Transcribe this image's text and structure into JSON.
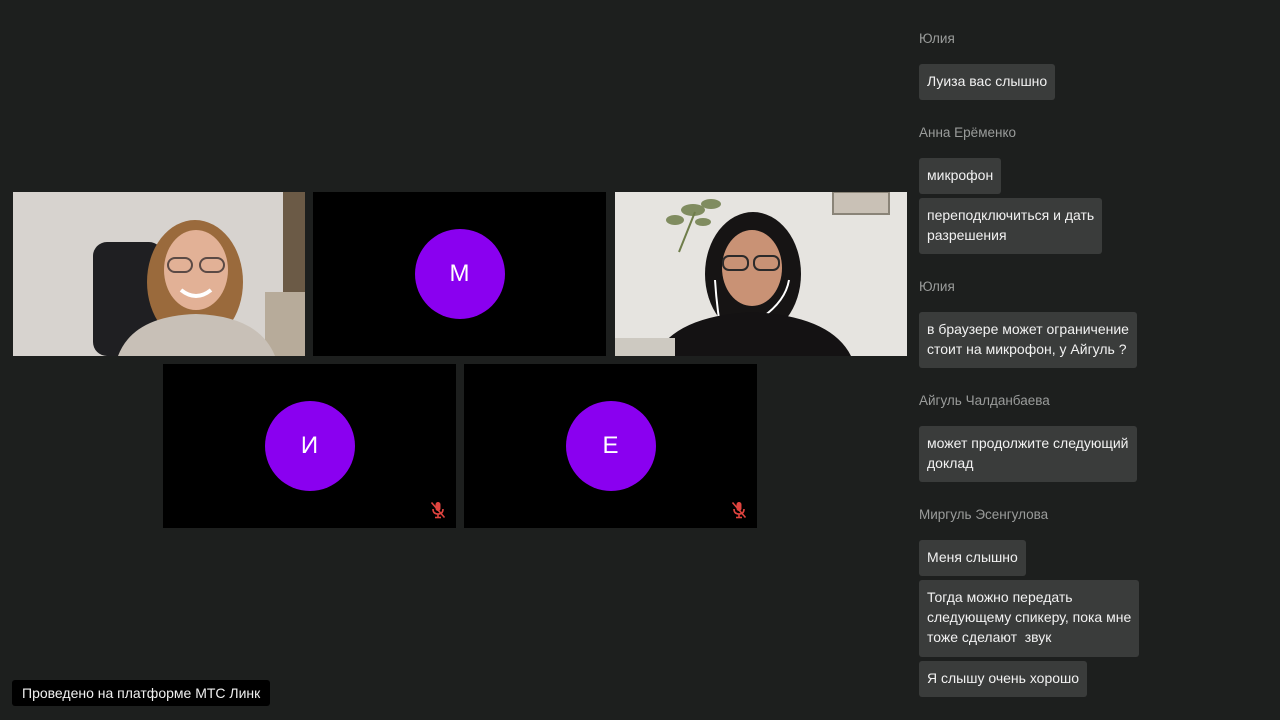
{
  "colors": {
    "background": "#1d1f1e",
    "avatar": "#8a00f0",
    "bubble": "#3a3c3b",
    "mic_off": "#e0443f"
  },
  "participants": [
    {
      "kind": "video",
      "description_icon": "participant-video-woman-smiling"
    },
    {
      "kind": "avatar",
      "initial": "М",
      "muted": false
    },
    {
      "kind": "video",
      "description_icon": "participant-video-woman-headphones"
    },
    {
      "kind": "avatar",
      "initial": "И",
      "muted": true
    },
    {
      "kind": "avatar",
      "initial": "Е",
      "muted": true
    }
  ],
  "chat": {
    "groups": [
      {
        "sender": "Юлия",
        "messages": [
          "Луиза вас слышно"
        ]
      },
      {
        "sender": "Анна Ерёменко",
        "messages": [
          "микрофон",
          "переподключиться и дать\nразрешения"
        ]
      },
      {
        "sender": "Юлия",
        "messages": [
          "в браузере может ограничение\nстоит на микрофон, у Айгуль ?"
        ]
      },
      {
        "sender": "Айгуль Чалданбаева",
        "messages": [
          "может продолжите следующий\nдоклад"
        ]
      },
      {
        "sender": "Миргуль Эсенгулова",
        "messages": [
          "Меня слышно",
          "Тогда можно передать\nследующему спикеру, пока мне\nтоже сделают  звук",
          "Я слышу очень хорошо"
        ]
      }
    ]
  },
  "footer": {
    "platform_label": "Проведено на платформе МТС Линк"
  }
}
